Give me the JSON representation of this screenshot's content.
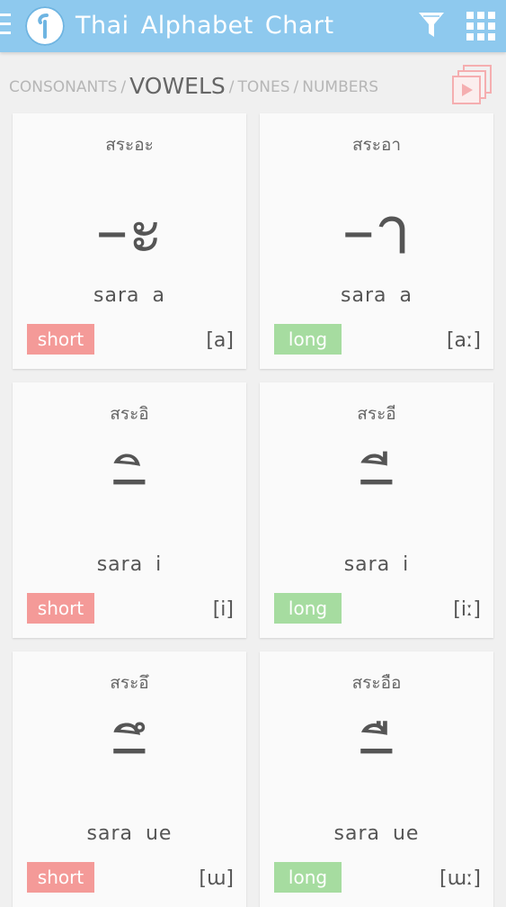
{
  "header": {
    "title": "Thai Alphabet Chart",
    "menu_icon": "hamburger-icon",
    "logo_icon": "app-logo-icon",
    "filter_icon": "filter-icon",
    "grid_icon": "grid-icon",
    "color": "#8ec9ee"
  },
  "categories": {
    "items": [
      "CONSONANTS",
      "VOWELS",
      "TONES",
      "NUMBERS"
    ],
    "active": "VOWELS",
    "separator": "/",
    "flashcard_icon": "flashcards-play-icon"
  },
  "cards": [
    {
      "thai_name": "สระอะ",
      "glyph": "–ะ",
      "roman": "sara a",
      "length": "short",
      "ipa": "[a]"
    },
    {
      "thai_name": "สระอา",
      "glyph": "–า",
      "roman": "sara a",
      "length": "long",
      "ipa": "[aː]"
    },
    {
      "thai_name": "สระอิ",
      "glyph": "–ิ",
      "roman": "sara i",
      "length": "short",
      "ipa": "[i]"
    },
    {
      "thai_name": "สระอี",
      "glyph": "–ี",
      "roman": "sara i",
      "length": "long",
      "ipa": "[iː]"
    },
    {
      "thai_name": "สระอึ",
      "glyph": "–ึ",
      "roman": "sara ue",
      "length": "short",
      "ipa": "[ɯ]"
    },
    {
      "thai_name": "สระอือ",
      "glyph": "–ื",
      "roman": "sara ue",
      "length": "long",
      "ipa": "[ɯː]"
    }
  ],
  "colors": {
    "short": "#f49a98",
    "long": "#a6dca0",
    "background": "#f0f0f0"
  }
}
